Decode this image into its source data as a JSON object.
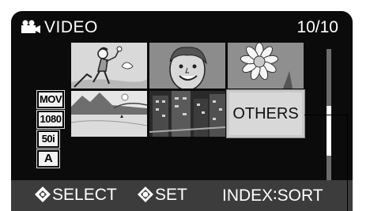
{
  "header": {
    "title": "VIDEO",
    "icon": "movie-camera-icon",
    "counter": "10/10"
  },
  "grid": {
    "others_label": "OTHERS",
    "thumbnails": [
      "child-playing-thumbnail",
      "smiling-boy-thumbnail",
      "flower-thumbnail",
      "lake-scene-thumbnail",
      "city-night-thumbnail",
      "others-folder"
    ]
  },
  "badges": {
    "format": "MOV",
    "resolution": "1080",
    "frame_rate": "50i",
    "mode": "A"
  },
  "scroll": {
    "position": 0.64
  },
  "footer": {
    "select_label": "SELECT",
    "set_label": "SET",
    "index_sort_label": "INDEX∶SORT"
  },
  "colors": {
    "screen_bg": "#0b0b0b",
    "footer_bg": "#3c3c3c",
    "text": "#ffffff",
    "selected_thumb": "#d8d8d8"
  }
}
